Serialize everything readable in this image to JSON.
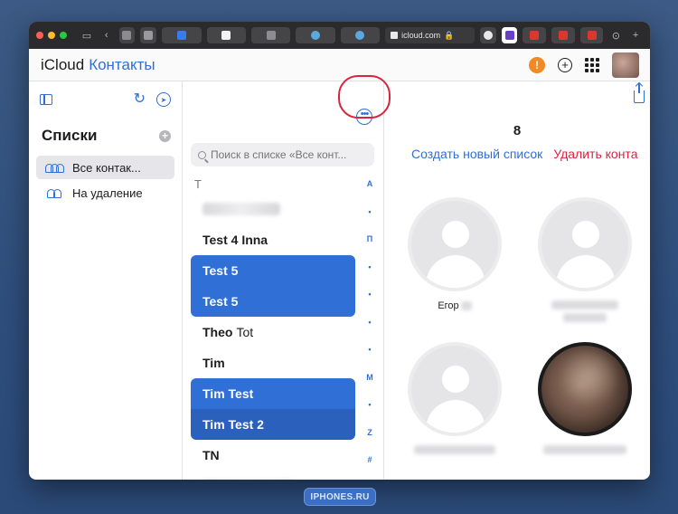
{
  "browser": {
    "url": "icloud.com",
    "tabs": [
      "",
      "",
      "",
      "",
      "",
      "",
      "",
      "",
      "",
      "",
      "",
      ""
    ]
  },
  "app": {
    "brand": "iCloud",
    "name": "Контакты"
  },
  "header": {
    "alert_symbol": "!"
  },
  "lists_panel": {
    "title": "Списки",
    "items": [
      {
        "label": "Все контак..."
      },
      {
        "label": "На удаление"
      }
    ]
  },
  "contacts_panel": {
    "search_placeholder": "Поиск в списке «Все конт...",
    "section": "T",
    "contacts": [
      {
        "first": "",
        "last": "",
        "blurred": true,
        "selected": false
      },
      {
        "first": "Test 4 Inna",
        "last": "",
        "selected": false
      },
      {
        "first": "Test 5",
        "last": "",
        "selected": true
      },
      {
        "first": "Test 5",
        "last": "",
        "selected": true
      },
      {
        "first": "Theo",
        "last": "Tot",
        "selected": false
      },
      {
        "first": "Tim",
        "last": "",
        "selected": false
      },
      {
        "first": "Tim Test",
        "last": "",
        "selected": true
      },
      {
        "first": "Tim Test 2",
        "last": "",
        "selected": true
      },
      {
        "first": "TN",
        "last": "",
        "selected": false
      },
      {
        "first": "",
        "last": "",
        "blurred": true,
        "selected": false
      }
    ],
    "index": [
      "А",
      "•",
      "П",
      "•",
      "•",
      "•",
      "•",
      "М",
      "•",
      "Z",
      "#"
    ]
  },
  "detail": {
    "count": "8",
    "create_list": "Создать новый список",
    "delete_contacts": "Удалить конта",
    "cards": [
      {
        "name": "Егор"
      },
      {
        "name": ""
      },
      {
        "name": ""
      },
      {
        "name": ""
      }
    ]
  },
  "watermark": "IPHONES.RU",
  "colors": {
    "accent": "#2f6fd6",
    "destructive": "#d8253f",
    "alert": "#f08a24"
  }
}
